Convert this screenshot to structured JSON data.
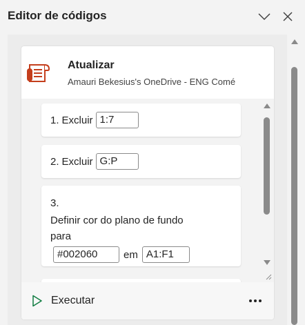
{
  "pane": {
    "title": "Editor de códigos",
    "icons": {
      "collapse": "chevron-down-icon",
      "close": "close-icon"
    }
  },
  "script": {
    "name": "Atualizar",
    "location": "Amauri Bekesius's OneDrive - ENG Comé",
    "icon": "script-icon"
  },
  "steps": [
    {
      "number": "1.",
      "action": "Excluir",
      "value": "1:7"
    },
    {
      "number": "2.",
      "action": "Excluir",
      "value": "G:P"
    },
    {
      "number": "3.",
      "action_line1": "Definir cor do plano de fundo",
      "action_line2": "para",
      "color": "#002060",
      "connector": "em",
      "range": "A1:F1"
    }
  ],
  "footer": {
    "run_label": "Executar",
    "run_icon": "play-icon",
    "more_icon": "more-icon"
  },
  "colors": {
    "accent_green": "#107c41",
    "script_icon_red": "#c43e1c"
  }
}
